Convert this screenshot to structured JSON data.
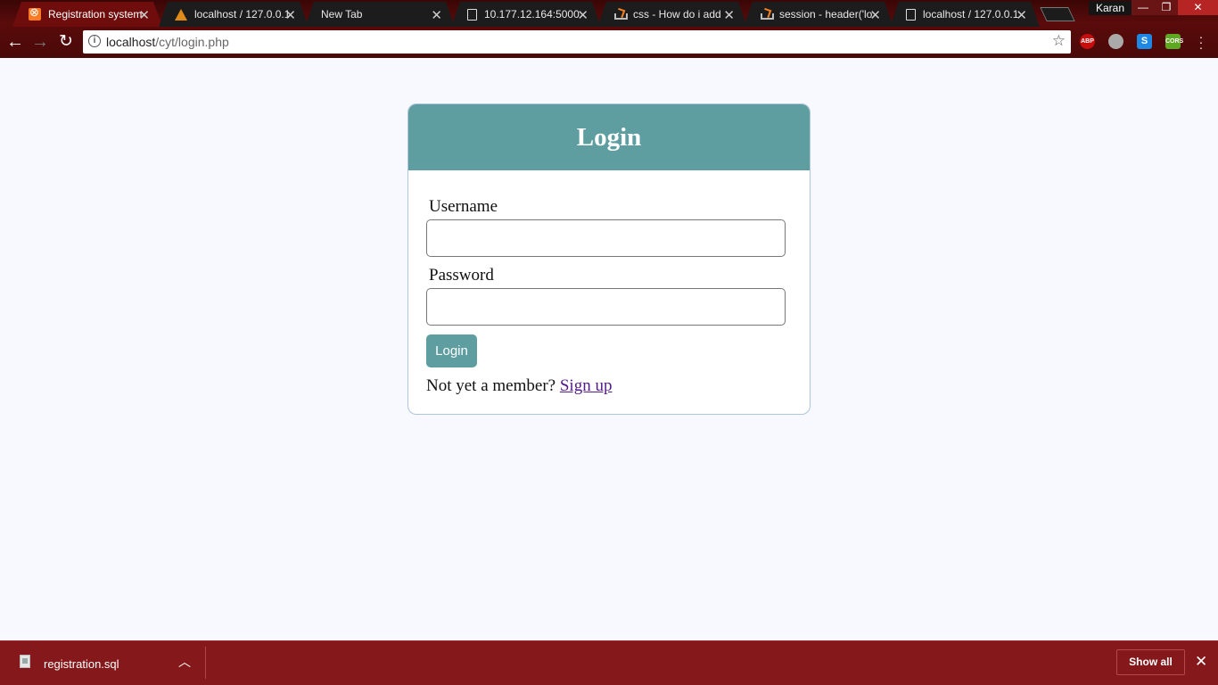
{
  "browser": {
    "tabs": [
      {
        "title": "Registration system",
        "favicon": "xampp-icon",
        "active": true
      },
      {
        "title": "localhost / 127.0.0.1",
        "favicon": "phpmyadmin-icon",
        "active": false
      },
      {
        "title": "New Tab",
        "favicon": "",
        "active": false
      },
      {
        "title": "10.177.12.164:5000",
        "favicon": "page-icon",
        "active": false
      },
      {
        "title": "css - How do i add",
        "favicon": "stackoverflow-icon",
        "active": false
      },
      {
        "title": "session - header('lo",
        "favicon": "stackoverflow-icon",
        "active": false
      },
      {
        "title": "localhost / 127.0.0.1",
        "favicon": "page-icon",
        "active": false
      }
    ],
    "profile_name": "Karan",
    "url_host": "localhost",
    "url_path": "/cyt/login.php",
    "extensions": {
      "abp": "ABP",
      "skype": "S",
      "cors": "CORS"
    }
  },
  "login": {
    "title": "Login",
    "username_label": "Username",
    "username_value": "",
    "password_label": "Password",
    "password_value": "",
    "submit_label": "Login",
    "signup_prompt": "Not yet a member?",
    "signup_link": "Sign up"
  },
  "downloads": {
    "file_name": "registration.sql",
    "show_all_label": "Show all"
  },
  "colors": {
    "accent": "#5f9ea0",
    "page_background": "#f8f8ff",
    "link": "#551a8b",
    "frame": "#85181a"
  }
}
